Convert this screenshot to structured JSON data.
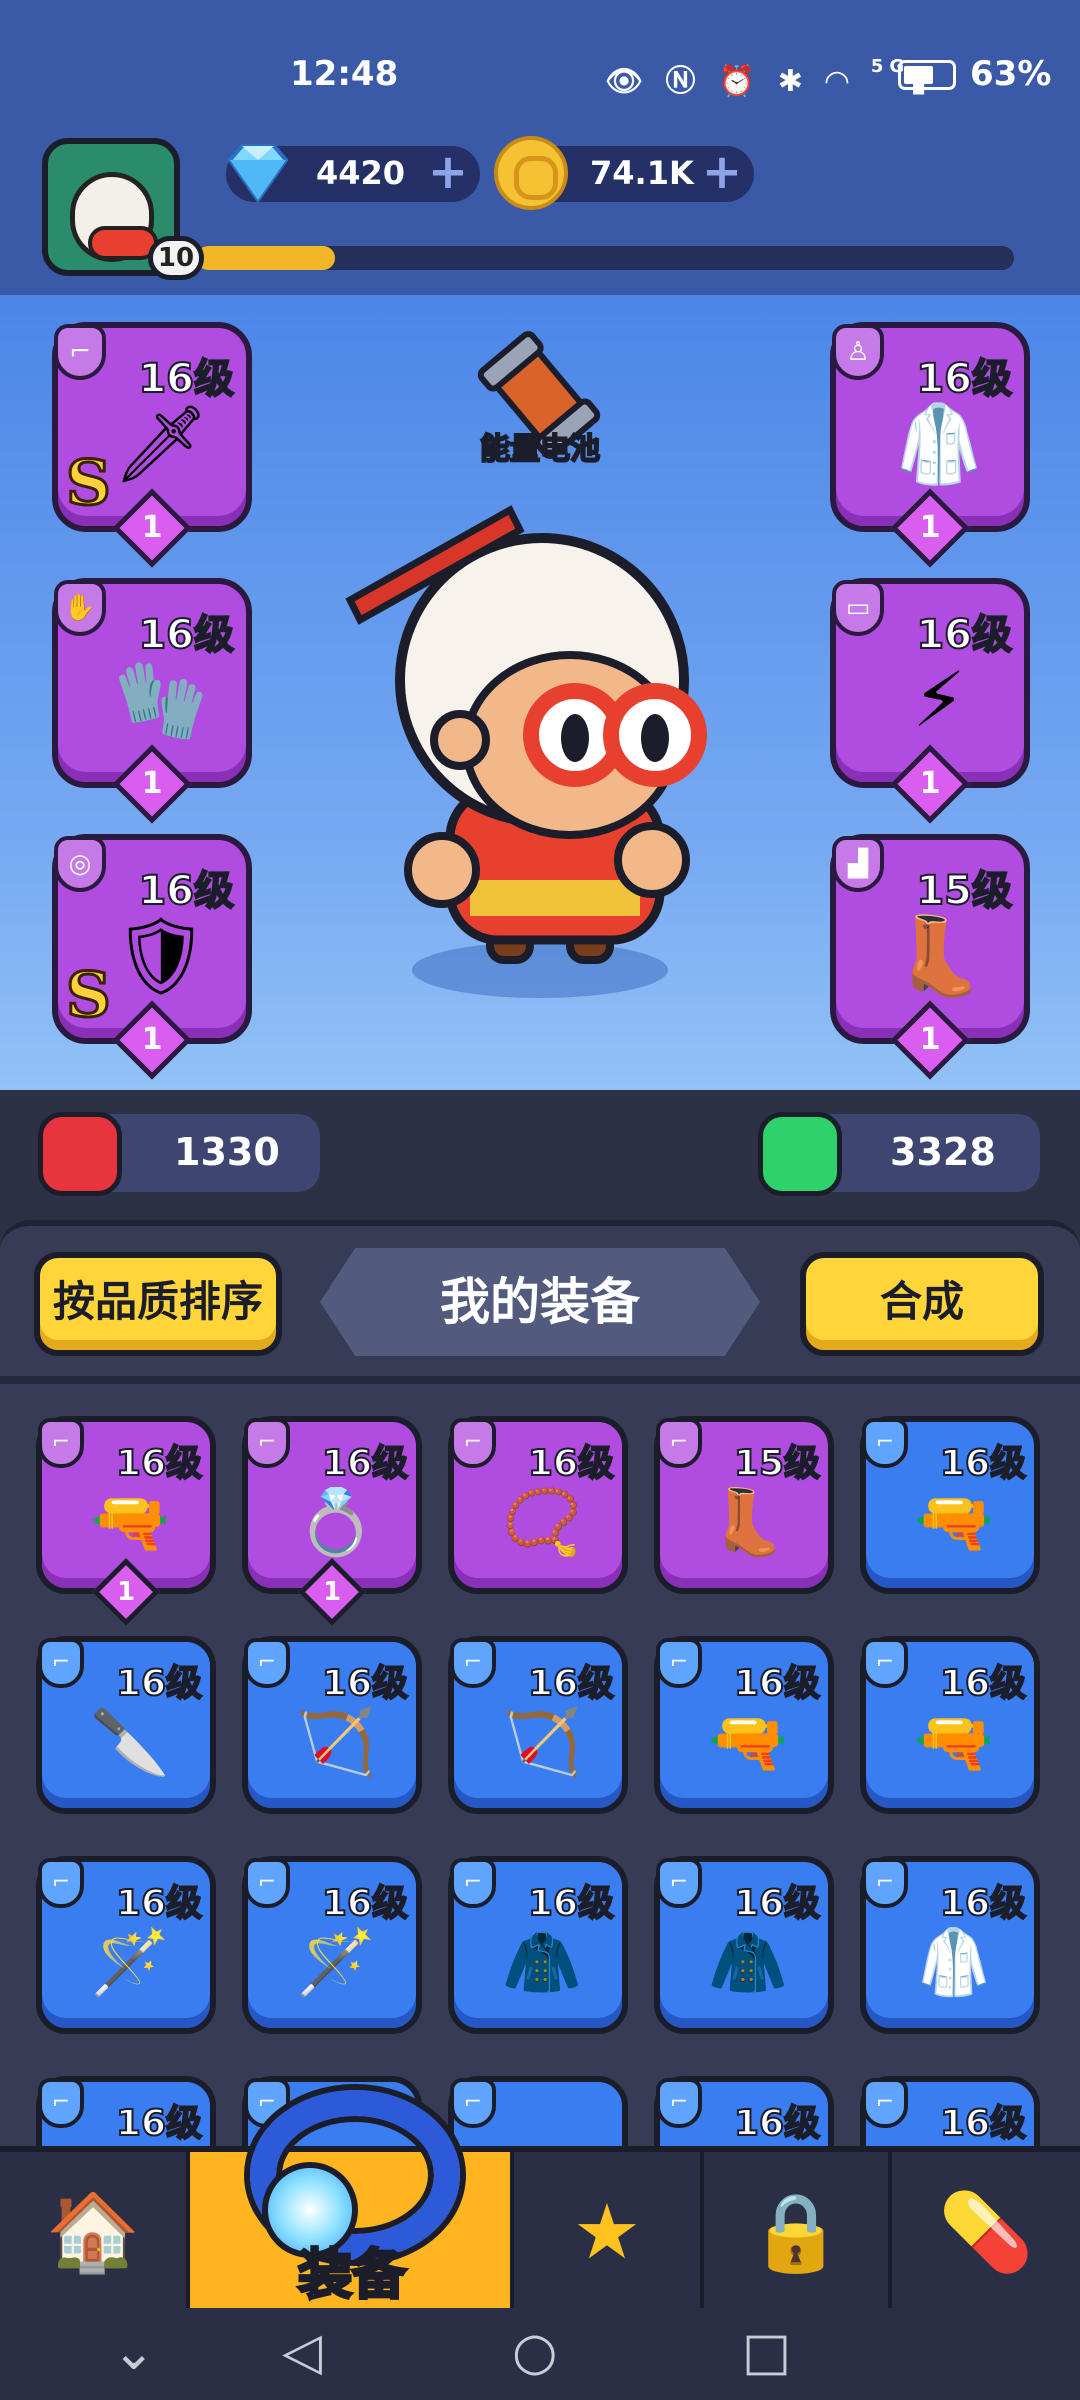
{
  "status_bar": {
    "time": "12:48",
    "network": "5G",
    "battery_percent": "63%",
    "battery_level": 0.63
  },
  "player": {
    "level": "10",
    "xp_fraction": 0.17
  },
  "currency": {
    "gems": "4420",
    "coins": "74.1K",
    "plus": "+"
  },
  "equipped": {
    "battery_label": "能量电池",
    "slots": [
      {
        "level": "16级",
        "icon": "dagger-icon",
        "tag": "pistol-tag",
        "grade": "S",
        "stars": "1",
        "side": "left"
      },
      {
        "level": "16级",
        "icon": "gloves-icon",
        "tag": "hand-tag",
        "grade": "",
        "stars": "1",
        "side": "left"
      },
      {
        "level": "16级",
        "icon": "amulet-icon",
        "tag": "ring-tag",
        "grade": "S",
        "stars": "1",
        "side": "left"
      },
      {
        "level": "16级",
        "icon": "robe-icon",
        "tag": "armor-tag",
        "grade": "",
        "stars": "1",
        "side": "right"
      },
      {
        "level": "16级",
        "icon": "belt-icon",
        "tag": "belt-tag",
        "grade": "",
        "stars": "1",
        "side": "right"
      },
      {
        "level": "15级",
        "icon": "boots-icon",
        "tag": "boot-tag",
        "grade": "",
        "stars": "1",
        "side": "right"
      }
    ]
  },
  "stats": {
    "attack": "1330",
    "health": "3328",
    "attack_color": "#e8343c",
    "health_color": "#2ed16a"
  },
  "inventory": {
    "sort_button": "按品质排序",
    "title": "我的装备",
    "merge_button": "合成",
    "items": [
      {
        "level": "16级",
        "rarity": "purple",
        "icon": "revolver-icon",
        "stars": "1"
      },
      {
        "level": "16级",
        "rarity": "purple",
        "icon": "ring-icon",
        "stars": "1"
      },
      {
        "level": "16级",
        "rarity": "purple",
        "icon": "necklace-icon",
        "stars": ""
      },
      {
        "level": "15级",
        "rarity": "purple",
        "icon": "boots-icon",
        "stars": ""
      },
      {
        "level": "16级",
        "rarity": "blue",
        "icon": "pistol-icon",
        "stars": ""
      },
      {
        "level": "16级",
        "rarity": "blue",
        "icon": "knife-icon",
        "stars": ""
      },
      {
        "level": "16级",
        "rarity": "blue",
        "icon": "crossbow-icon",
        "stars": ""
      },
      {
        "level": "16级",
        "rarity": "blue",
        "icon": "crossbow-icon",
        "stars": ""
      },
      {
        "level": "16级",
        "rarity": "blue",
        "icon": "shotgun-icon",
        "stars": ""
      },
      {
        "level": "16级",
        "rarity": "blue",
        "icon": "shotgun-icon",
        "stars": ""
      },
      {
        "level": "16级",
        "rarity": "blue",
        "icon": "staff-icon",
        "stars": ""
      },
      {
        "level": "16级",
        "rarity": "blue",
        "icon": "staff-icon",
        "stars": ""
      },
      {
        "level": "16级",
        "rarity": "blue",
        "icon": "cloak-icon",
        "stars": ""
      },
      {
        "level": "16级",
        "rarity": "blue",
        "icon": "cloak-icon",
        "stars": ""
      },
      {
        "level": "16级",
        "rarity": "blue",
        "icon": "robe-icon",
        "stars": ""
      },
      {
        "level": "16级",
        "rarity": "blue",
        "icon": "armor-icon",
        "stars": ""
      },
      {
        "level": "",
        "rarity": "blue",
        "icon": "ring-icon",
        "stars": ""
      },
      {
        "level": "",
        "rarity": "blue",
        "icon": "ring-icon",
        "stars": ""
      },
      {
        "level": "16级",
        "rarity": "blue",
        "icon": "ring-icon",
        "stars": ""
      },
      {
        "level": "16级",
        "rarity": "blue",
        "icon": "ring-icon",
        "stars": ""
      }
    ]
  },
  "nav": {
    "active_label": "装备",
    "tabs": [
      {
        "icon": "shop-icon"
      },
      {
        "icon": "equipment-icon"
      },
      {
        "icon": "battle-star-icon"
      },
      {
        "icon": "lock-icon"
      },
      {
        "icon": "capsule-icon"
      }
    ]
  }
}
